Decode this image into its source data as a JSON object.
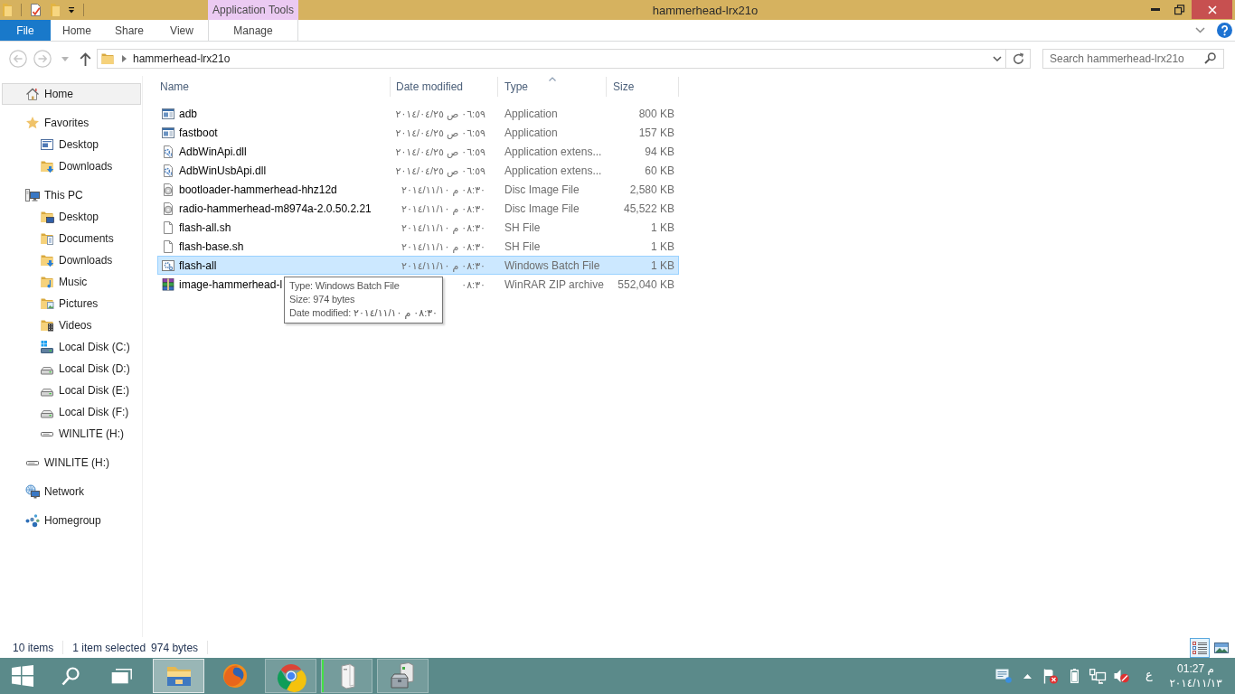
{
  "window": {
    "title": "hammerhead-lrx21o"
  },
  "ribbon": {
    "tabs": [
      {
        "label": "File",
        "kind": "file"
      },
      {
        "label": "Home",
        "kind": "tab"
      },
      {
        "label": "Share",
        "kind": "tab"
      },
      {
        "label": "View",
        "kind": "tab"
      }
    ],
    "context_group": {
      "title": "Application Tools",
      "tabs": [
        {
          "label": "Manage"
        }
      ]
    }
  },
  "navigation": {
    "back": {
      "disabled": true
    },
    "forward": {
      "disabled": true
    },
    "up": {
      "disabled": false
    }
  },
  "address_bar": {
    "path": [
      "hammerhead-lrx21o"
    ]
  },
  "search": {
    "placeholder": "Search hammerhead-lrx21o"
  },
  "sidebar": {
    "items": [
      {
        "label": "Home",
        "kind": "home",
        "selected": true
      },
      {
        "label": "Favorites",
        "kind": "star",
        "selected": false,
        "children": [
          {
            "label": "Desktop",
            "kind": "screen",
            "selected": false
          },
          {
            "label": "Downloads",
            "kind": "downloads",
            "selected": false
          }
        ]
      },
      {
        "label": "This PC",
        "kind": "computer",
        "selected": false,
        "children": [
          {
            "label": "Desktop",
            "kind": "desktop",
            "selected": false
          },
          {
            "label": "Documents",
            "kind": "documents",
            "selected": false
          },
          {
            "label": "Downloads",
            "kind": "downloads",
            "selected": false
          },
          {
            "label": "Music",
            "kind": "music",
            "selected": false
          },
          {
            "label": "Pictures",
            "kind": "pictures",
            "selected": false
          },
          {
            "label": "Videos",
            "kind": "videos",
            "selected": false
          },
          {
            "label": "Local Disk (C:)",
            "kind": "systemdisk",
            "selected": false
          },
          {
            "label": "Local Disk (D:)",
            "kind": "disk",
            "selected": false
          },
          {
            "label": "Local Disk (E:)",
            "kind": "disk",
            "selected": false
          },
          {
            "label": "Local Disk (F:)",
            "kind": "disk",
            "selected": false
          },
          {
            "label": "WINLITE (H:)",
            "kind": "removable",
            "selected": false
          }
        ]
      },
      {
        "label": "WINLITE (H:)",
        "kind": "removable",
        "selected": false
      },
      {
        "label": "Network",
        "kind": "network",
        "selected": false
      },
      {
        "label": "Homegroup",
        "kind": "homegroup",
        "selected": false
      }
    ]
  },
  "file_list": {
    "columns": [
      {
        "label": "Name",
        "sorted": false
      },
      {
        "label": "Date modified",
        "sorted": false
      },
      {
        "label": "Type",
        "sorted": true
      },
      {
        "label": "Size",
        "sorted": false
      }
    ],
    "rows": [
      {
        "kind": "application",
        "name": "adb",
        "date": "٠٦:٥٩ ص ٢٠١٤/٠٤/٢٥",
        "type": "Application",
        "size": "800 KB",
        "selected": false
      },
      {
        "kind": "application",
        "name": "fastboot",
        "date": "٠٦:٥٩ ص ٢٠١٤/٠٤/٢٥",
        "type": "Application",
        "size": "157 KB",
        "selected": false
      },
      {
        "kind": "extension",
        "name": "AdbWinApi.dll",
        "date": "٠٦:٥٩ ص ٢٠١٤/٠٤/٢٥",
        "type": "Application extens...",
        "size": "94 KB",
        "selected": false
      },
      {
        "kind": "extension",
        "name": "AdbWinUsbApi.dll",
        "date": "٠٦:٥٩ ص ٢٠١٤/٠٤/٢٥",
        "type": "Application extens...",
        "size": "60 KB",
        "selected": false
      },
      {
        "kind": "discimage",
        "name": "bootloader-hammerhead-hhz12d",
        "date": "٠٨:٣٠ م ٢٠١٤/١١/١٠",
        "type": "Disc Image File",
        "size": "2,580 KB",
        "selected": false
      },
      {
        "kind": "discimage",
        "name": "radio-hammerhead-m8974a-2.0.50.2.21",
        "date": "٠٨:٣٠ م ٢٠١٤/١١/١٠",
        "type": "Disc Image File",
        "size": "45,522 KB",
        "selected": false
      },
      {
        "kind": "document",
        "name": "flash-all.sh",
        "date": "٠٨:٣٠ م ٢٠١٤/١١/١٠",
        "type": "SH File",
        "size": "1 KB",
        "selected": false
      },
      {
        "kind": "document",
        "name": "flash-base.sh",
        "date": "٠٨:٣٠ م ٢٠١٤/١١/١٠",
        "type": "SH File",
        "size": "1 KB",
        "selected": false
      },
      {
        "kind": "batch",
        "name": "flash-all",
        "date": "٠٨:٣٠ م ٢٠١٤/١١/١٠",
        "type": "Windows Batch File",
        "size": "1 KB",
        "selected": true
      },
      {
        "kind": "archive",
        "name": "image-hammerhead-l",
        "date": "٠٨:٣٠",
        "type": "WinRAR ZIP archive",
        "size": "552,040 KB",
        "selected": false
      }
    ]
  },
  "tooltip": {
    "lines": [
      "Type: Windows Batch File",
      "Size: 974 bytes",
      "Date modified: ٠٨:٣٠ م ٢٠١٤/١١/١٠"
    ]
  },
  "status_bar": {
    "item_count": "10 items",
    "selection": "1 item selected",
    "selection_size": "974 bytes",
    "views": [
      {
        "selected": true
      },
      {
        "selected": false
      }
    ]
  },
  "taskbar": {
    "apps": [
      {
        "selected": true,
        "running": true
      },
      {
        "selected": false,
        "running": false
      },
      {
        "selected": false,
        "running": true
      },
      {
        "selected": false,
        "running": true,
        "level": 0.03
      },
      {
        "selected": false,
        "running": true
      }
    ],
    "input_language": "ع",
    "clock": {
      "time": "01:27 م",
      "date": "٢٠١٤/١١/١٣"
    }
  }
}
